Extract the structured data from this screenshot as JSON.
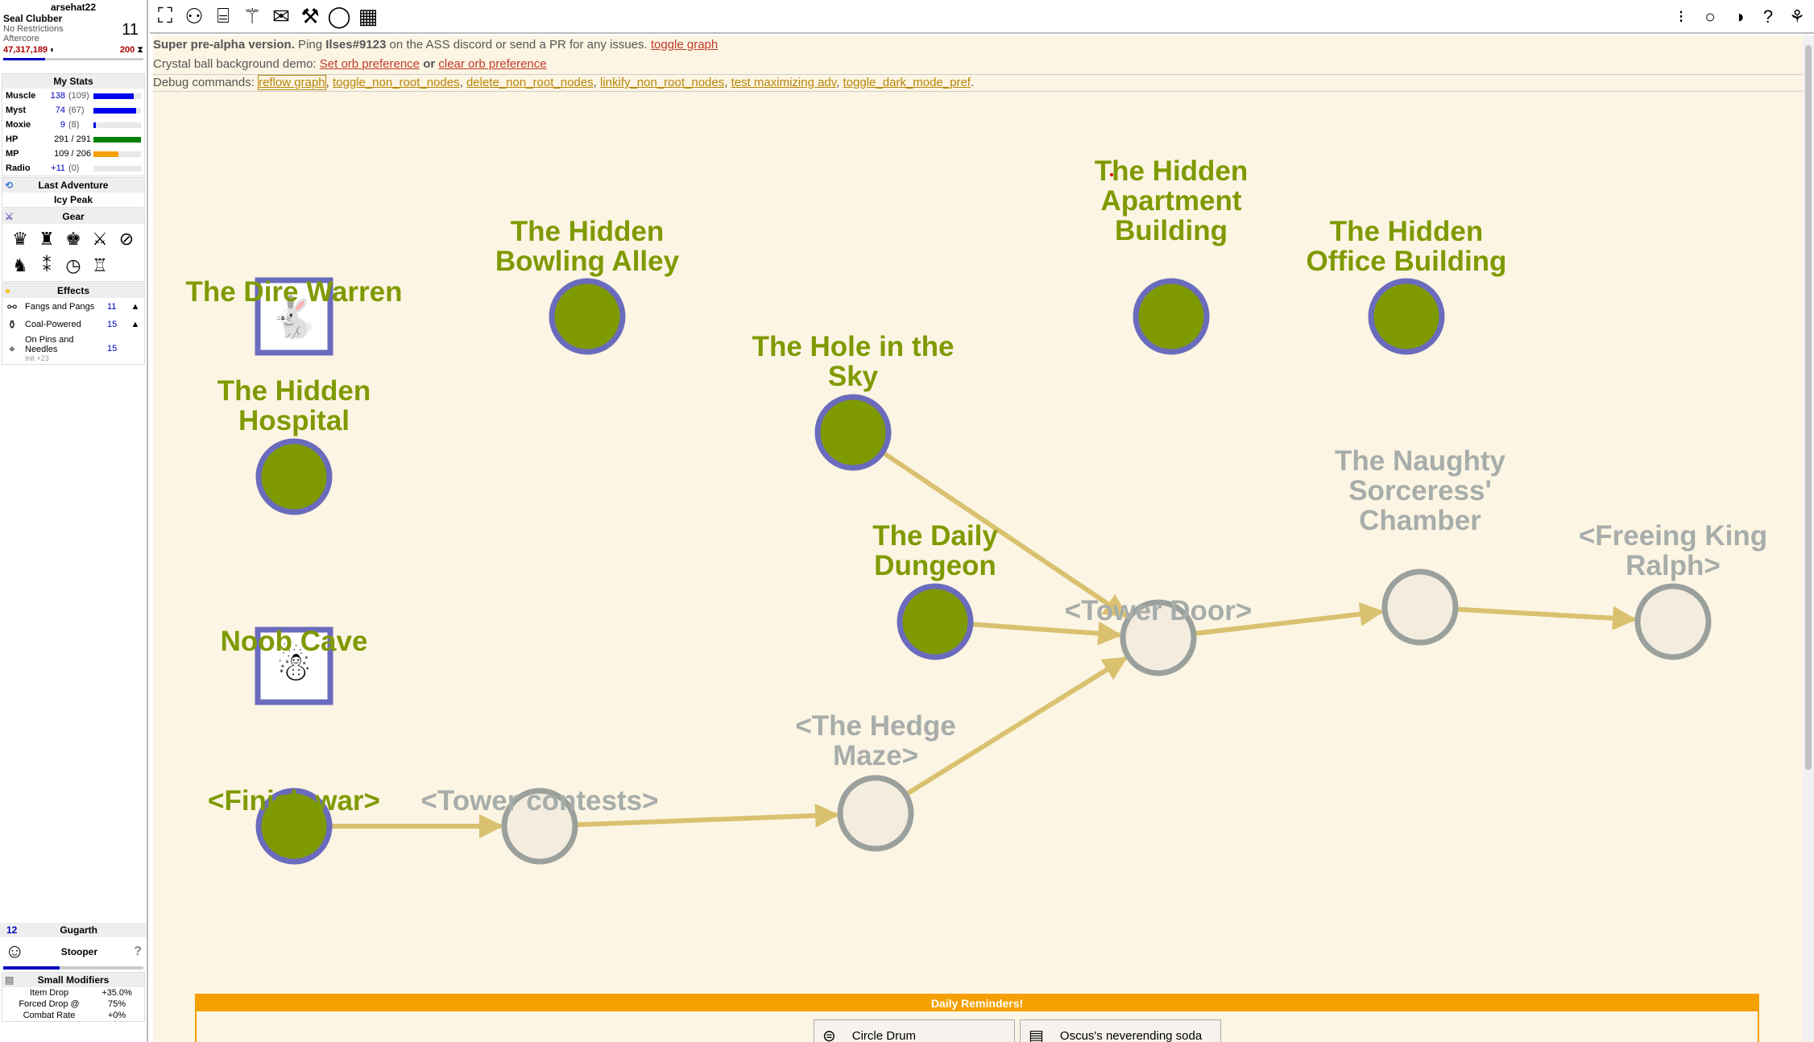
{
  "character": {
    "name": "arsehat22",
    "class": "Seal Clubber",
    "path": "No Restrictions",
    "sign": "Aftercore",
    "level": "11",
    "meat": "47,317,189",
    "adventures": "200"
  },
  "stats": {
    "header": "My Stats",
    "rows": [
      {
        "name": "Muscle",
        "value": "138",
        "base": "(109)",
        "fill": 0.85,
        "color": "#0000ee"
      },
      {
        "name": "Myst",
        "value": "74",
        "base": "(67)",
        "fill": 0.9,
        "color": "#0000ee"
      },
      {
        "name": "Moxie",
        "value": "9",
        "base": "(8)",
        "fill": 0.05,
        "color": "#0000ee"
      }
    ],
    "hp": {
      "name": "HP",
      "value": "291 / 291",
      "fill": 1.0,
      "color": "#008000"
    },
    "mp": {
      "name": "MP",
      "value": "109 / 206",
      "fill": 0.53,
      "color": "#f5a000"
    },
    "radio": {
      "name": "Radio",
      "value": "+11",
      "base": "(0)",
      "fill": 0.0
    }
  },
  "last_adventure": {
    "header": "Last Adventure",
    "name": "Icy Peak"
  },
  "gear": {
    "header": "Gear",
    "icons": [
      "crown-icon",
      "shirt-icon",
      "jacket-icon",
      "sword-icon",
      "no-icon",
      "boot-icon",
      "numbers-icon",
      "clock-icon",
      "robot-icon"
    ]
  },
  "effects": {
    "header": "Effects",
    "list": [
      {
        "name": "Fangs and Pangs",
        "duration": "11",
        "sub": ""
      },
      {
        "name": "Coal-Powered",
        "duration": "15",
        "sub": ""
      },
      {
        "name": "On Pins and Needles",
        "duration": "15",
        "sub": "Init +23"
      }
    ]
  },
  "familiar": {
    "weight": "12",
    "name": "Gugarth",
    "type": "Stooper"
  },
  "modifiers": {
    "header": "Small Modifiers",
    "rows": [
      {
        "name": "Item Drop",
        "value": "+35.0%"
      },
      {
        "name": "Forced Drop @",
        "value": "75%"
      },
      {
        "name": "Combat Rate",
        "value": "+0%"
      }
    ]
  },
  "banner": {
    "line1_bold": "Super pre-alpha version.",
    "line1_text": " Ping ",
    "line1_handle": "Ilses#9123",
    "line1_rest": " on the ASS discord or send a PR for any issues. ",
    "line1_link": "toggle graph",
    "line2_text": "Crystal ball background demo: ",
    "line2_link1": "Set orb preference",
    "line2_or": " or ",
    "line2_link2": "clear orb preference",
    "debug_label": "Debug commands: ",
    "debug_links": [
      "reflow graph",
      "toggle_non_root_nodes",
      "delete_non_root_nodes",
      "linkify_non_root_nodes",
      "test maximizing adv",
      "toggle_dark_mode_pref"
    ]
  },
  "graph_nodes": [
    {
      "id": "dire",
      "lines": [
        "The Dire Warren"
      ],
      "active": true,
      "shape": "box",
      "icon": "rabbit-icon"
    },
    {
      "id": "bowling",
      "lines": [
        "The Hidden",
        "Bowling Alley"
      ],
      "active": true,
      "shape": "circle"
    },
    {
      "id": "apartment",
      "lines": [
        "The Hidden",
        "Apartment",
        "Building"
      ],
      "active": true,
      "shape": "circle"
    },
    {
      "id": "office",
      "lines": [
        "The Hidden",
        "Office Building"
      ],
      "active": true,
      "shape": "circle"
    },
    {
      "id": "hospital",
      "lines": [
        "The Hidden",
        "Hospital"
      ],
      "active": true,
      "shape": "circle"
    },
    {
      "id": "hole",
      "lines": [
        "The Hole in the",
        "Sky"
      ],
      "active": true,
      "shape": "circle"
    },
    {
      "id": "daily",
      "lines": [
        "The Daily",
        "Dungeon"
      ],
      "active": true,
      "shape": "circle"
    },
    {
      "id": "noob",
      "lines": [
        "Noob Cave"
      ],
      "active": true,
      "shape": "box",
      "icon": "snowman-icon"
    },
    {
      "id": "finish",
      "lines": [
        "<Finish war>"
      ],
      "active": true,
      "shape": "circle"
    },
    {
      "id": "contests",
      "lines": [
        "<Tower contests>"
      ],
      "active": false,
      "shape": "circle"
    },
    {
      "id": "hedge",
      "lines": [
        "<The Hedge",
        "Maze>"
      ],
      "active": false,
      "shape": "circle"
    },
    {
      "id": "door",
      "lines": [
        "<Tower Door>"
      ],
      "active": false,
      "shape": "circle"
    },
    {
      "id": "naughty",
      "lines": [
        "The Naughty",
        "Sorceress'",
        "Chamber"
      ],
      "active": false,
      "shape": "circle"
    },
    {
      "id": "ralph",
      "lines": [
        "<Freeing King",
        "Ralph>"
      ],
      "active": false,
      "shape": "circle"
    }
  ],
  "graph_edges": [
    [
      "finish",
      "contests"
    ],
    [
      "contests",
      "hedge"
    ],
    [
      "hedge",
      "door"
    ],
    [
      "hole",
      "door"
    ],
    [
      "daily",
      "door"
    ],
    [
      "door",
      "naughty"
    ],
    [
      "naughty",
      "ralph"
    ]
  ],
  "colors": {
    "active_fill": "#7f9a00",
    "active_border": "#6b6bbd",
    "inactive_fill": "#f3ecdf",
    "inactive_border": "#9aa19d",
    "active_text": "#7f9a00",
    "inactive_text": "#a7adaa",
    "edge": "#d9c16f"
  },
  "reminders": {
    "header": "Daily Reminders!",
    "items": [
      {
        "label": "Circle Drum",
        "icon": "drum-icon"
      },
      {
        "label": "Oscus's neverending soda",
        "icon": "soda-icon"
      }
    ]
  }
}
